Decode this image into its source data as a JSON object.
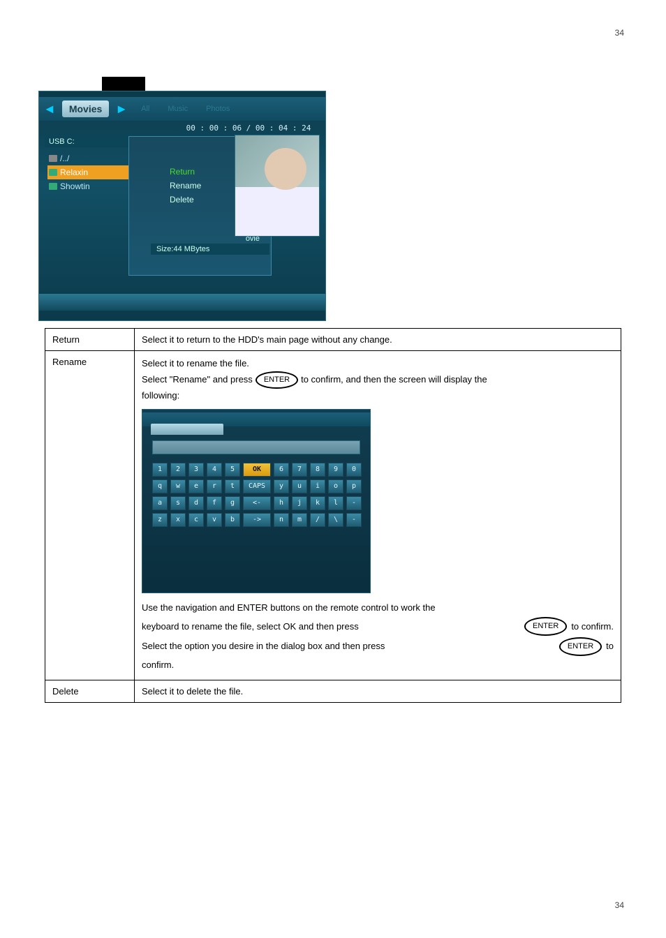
{
  "page_number_top": "34",
  "page_number_bottom": "34",
  "shot1": {
    "tabs": {
      "active": "Movies",
      "t1": "All",
      "t2": "Music",
      "t3": "Photos"
    },
    "time": "00 : 00 : 06 / 00 : 04 : 24",
    "usb": "USB   C:",
    "items": {
      "up": "/../",
      "i1": "Relaxin",
      "i2": "Showtin"
    },
    "popup": {
      "p0": "Return",
      "p1": "Rename",
      "p2": "Delete"
    },
    "ovie": "ovie",
    "size": "Size:44 MBytes"
  },
  "row1": {
    "label": "Return",
    "desc": "Select it to return to the HDD's main page without any change."
  },
  "row2": {
    "label": "Rename",
    "line1": "Select it to rename the file.",
    "line2a": "Select \"Rename\" and press",
    "line2b": "to confirm, and then the screen will display the",
    "line3": "following:",
    "kb": {
      "r1": [
        "1",
        "2",
        "3",
        "4",
        "5",
        "OK",
        "6",
        "7",
        "8",
        "9",
        "0"
      ],
      "r2": [
        "q",
        "w",
        "e",
        "r",
        "t",
        "CAPS",
        "y",
        "u",
        "i",
        "o",
        "p"
      ],
      "r3": [
        "a",
        "s",
        "d",
        "f",
        "g",
        "<-",
        "h",
        "j",
        "k",
        "l",
        "-"
      ],
      "r4": [
        "z",
        "x",
        "c",
        "v",
        "b",
        "->",
        "n",
        "m",
        "/",
        "\\",
        "-"
      ]
    },
    "l4": "Use the navigation and ENTER buttons on the remote control to work the",
    "l5a": "keyboard to rename the file, select OK and then press",
    "l5b": "to confirm.",
    "l6a": "Select the option you desire in the dialog box and then press",
    "l6b": "to",
    "l7": "confirm."
  },
  "row3": {
    "label": "Delete",
    "desc": "Select it to delete the file."
  },
  "enter_label": "ENTER"
}
